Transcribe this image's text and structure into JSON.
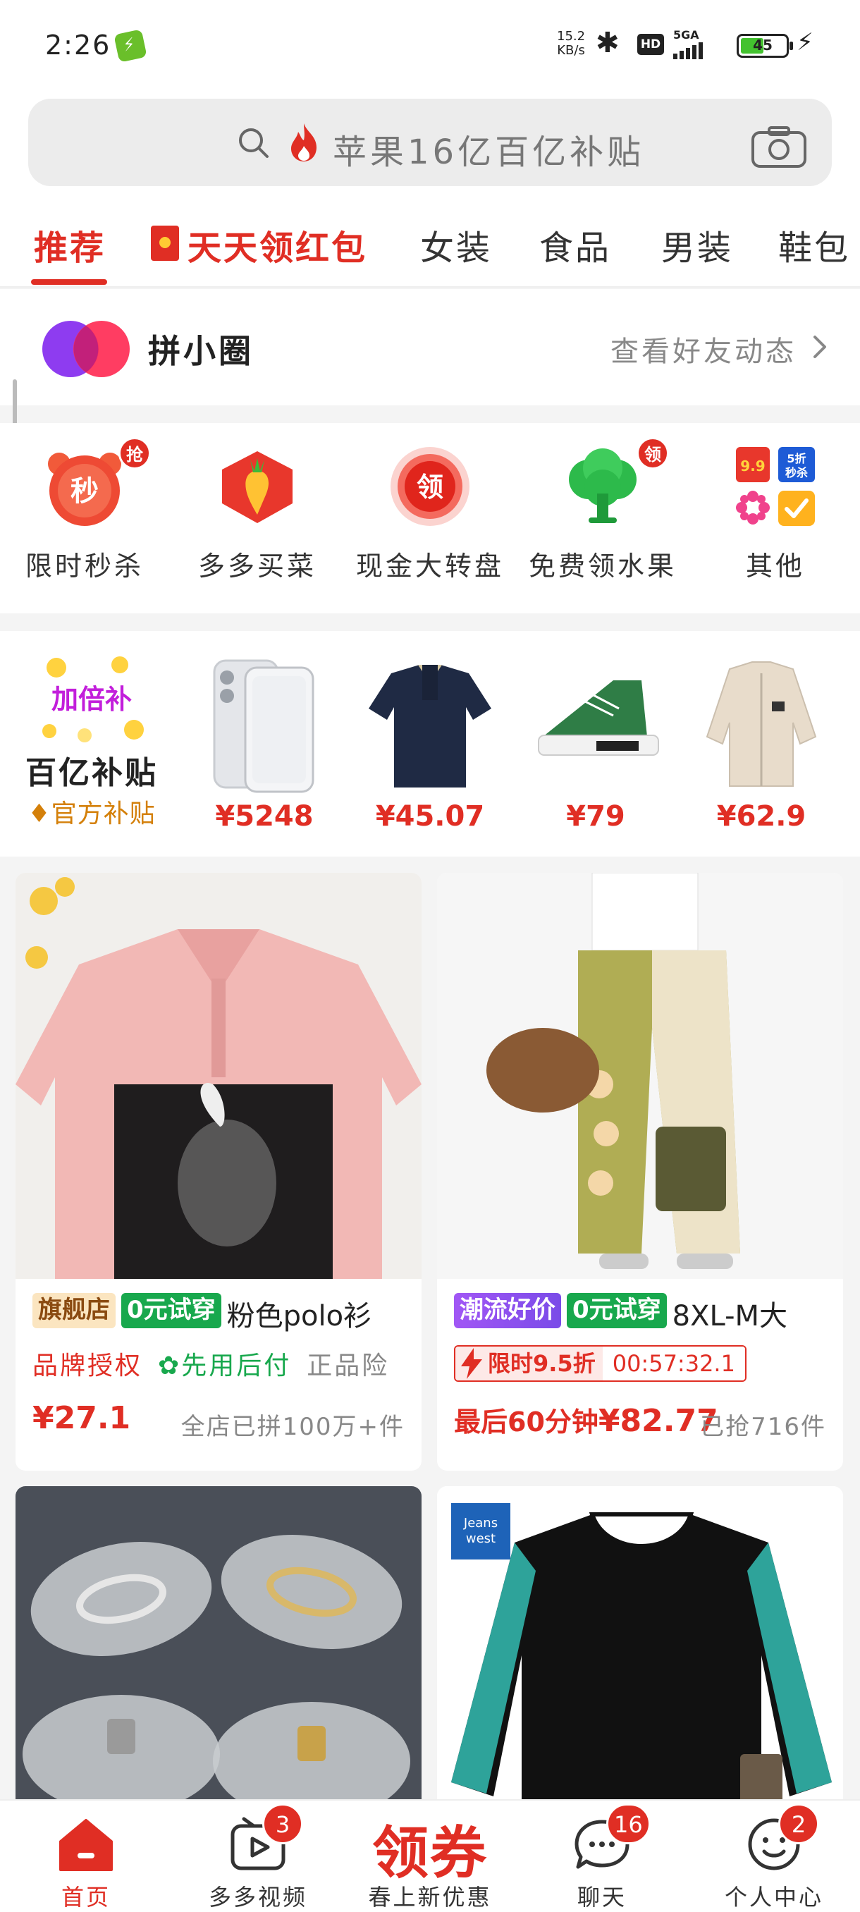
{
  "status_bar": {
    "time": "2:26",
    "net_speed_value": "15.2",
    "net_speed_unit": "KB/s",
    "hd": "HD",
    "signal": "5GA",
    "battery": "45"
  },
  "search": {
    "placeholder": "苹果16亿百亿补贴"
  },
  "tabs": [
    {
      "label": "推荐",
      "active": true
    },
    {
      "label": "天天领红包"
    },
    {
      "label": "女装"
    },
    {
      "label": "食品"
    },
    {
      "label": "男装"
    },
    {
      "label": "鞋包"
    }
  ],
  "friend_circle": {
    "title": "拼小圈",
    "link": "查看好友动态"
  },
  "shortcuts": [
    {
      "label": "限时秒杀",
      "icon": "alarm-clock-icon",
      "badge": "抢",
      "icon_text": "秒"
    },
    {
      "label": "多多买菜",
      "icon": "carrot-icon"
    },
    {
      "label": "现金大转盘",
      "icon": "wheel-icon",
      "icon_text": "领"
    },
    {
      "label": "免费领水果",
      "icon": "tree-icon",
      "badge": "领"
    },
    {
      "label": "其他",
      "icon": "apps-grid-icon",
      "mini_labels": [
        "9.9",
        "5折 秒杀"
      ]
    }
  ],
  "subsidy": {
    "promo": "加倍补",
    "title": "百亿补贴",
    "badge": "官方补贴",
    "items": [
      {
        "name": "phone",
        "price": "¥5248"
      },
      {
        "name": "polo-shirt",
        "price": "¥45.07"
      },
      {
        "name": "sneaker",
        "price": "¥79"
      },
      {
        "name": "shirt-jacket",
        "price": "¥62.9"
      }
    ]
  },
  "feed": [
    {
      "tags": [
        "旗舰店",
        "0元试穿"
      ],
      "title": "粉色polo衫",
      "services": [
        "品牌授权",
        "先用后付",
        "正品险"
      ],
      "price": "¥27.1",
      "sold": "全店已拼100万+件"
    },
    {
      "tags": [
        "潮流好价",
        "0元试穿"
      ],
      "title": "8XL-M大",
      "flash_label": "限时9.5折",
      "flash_timer": "00:57:32.1",
      "price_prefix": "最后60分钟",
      "price": "¥82.77",
      "sold": "已抢716件"
    },
    {
      "name": "nose-pads"
    },
    {
      "brand": "Jeans west 真维斯"
    }
  ],
  "bottom_nav": [
    {
      "label": "首页",
      "active": true
    },
    {
      "label": "多多视频",
      "badge": "3"
    },
    {
      "label": "春上新优惠",
      "big": "领券"
    },
    {
      "label": "聊天",
      "badge": "16"
    },
    {
      "label": "个人中心",
      "badge": "2"
    }
  ],
  "colors": {
    "brand_red": "#e02e24",
    "green": "#18a84d",
    "gold": "#d4800a"
  }
}
